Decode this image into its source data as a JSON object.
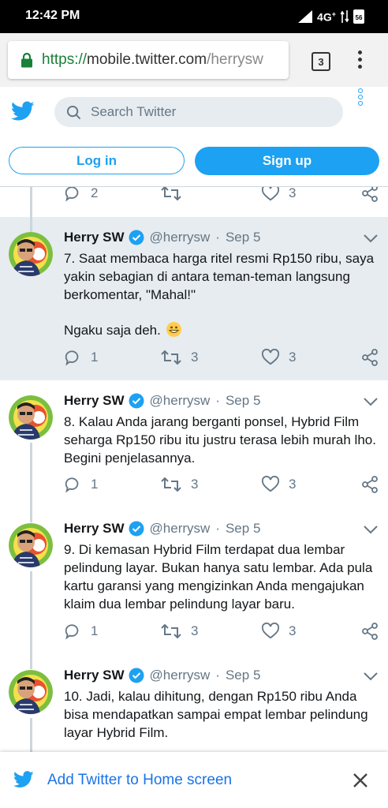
{
  "status_bar": {
    "time": "12:42 PM",
    "network": "4G",
    "network_sup": "+",
    "sim_badge": "56"
  },
  "browser": {
    "url_scheme": "https://",
    "url_host": "mobile.twitter.com",
    "url_path": "/herrysw",
    "tab_count": "3",
    "icons": [
      "lock-icon",
      "overflow-menu-icon"
    ]
  },
  "twitter_header": {
    "search_placeholder": "Search Twitter",
    "login_label": "Log in",
    "signup_label": "Sign up"
  },
  "prev_tweet_actions": {
    "replies": "2",
    "retweets": "",
    "likes": "3"
  },
  "tweets": [
    {
      "name": "Herry SW",
      "handle": "@herrysw",
      "separator": "·",
      "date": "Sep 5",
      "text": "7. Saat membaca harga ritel resmi Rp150 ribu, saya yakin sebagian di antara teman-teman langsung berkomentar, \"Mahal!\"",
      "text2": "Ngaku saja deh.",
      "emoji": "grinning-face",
      "replies": "1",
      "retweets": "3",
      "likes": "3",
      "highlighted": true
    },
    {
      "name": "Herry SW",
      "handle": "@herrysw",
      "separator": "·",
      "date": "Sep 5",
      "text": "8. Kalau Anda jarang berganti ponsel, Hybrid Film seharga Rp150 ribu itu justru terasa lebih murah lho. Begini penjelasannya.",
      "replies": "1",
      "retweets": "3",
      "likes": "3"
    },
    {
      "name": "Herry SW",
      "handle": "@herrysw",
      "separator": "·",
      "date": "Sep 5",
      "text": "9. Di kemasan Hybrid Film terdapat dua lembar pelindung layar. Bukan hanya satu lembar. Ada pula kartu garansi yang mengizinkan Anda mengajukan klaim dua lembar pelindung layar baru.",
      "replies": "1",
      "retweets": "3",
      "likes": "3"
    },
    {
      "name": "Herry SW",
      "handle": "@herrysw",
      "separator": "·",
      "date": "Sep 5",
      "text": "10. Jadi, kalau dihitung, dengan Rp150 ribu Anda bisa mendapatkan sampai empat lembar pelindung layar Hybrid Film."
    }
  ],
  "banner": {
    "text": "Add Twitter to Home screen"
  },
  "colors": {
    "twitter_blue": "#1da1f2",
    "highlight_bg": "#e6ecf0",
    "secondary_text": "#657786",
    "url_green": "#188038"
  }
}
